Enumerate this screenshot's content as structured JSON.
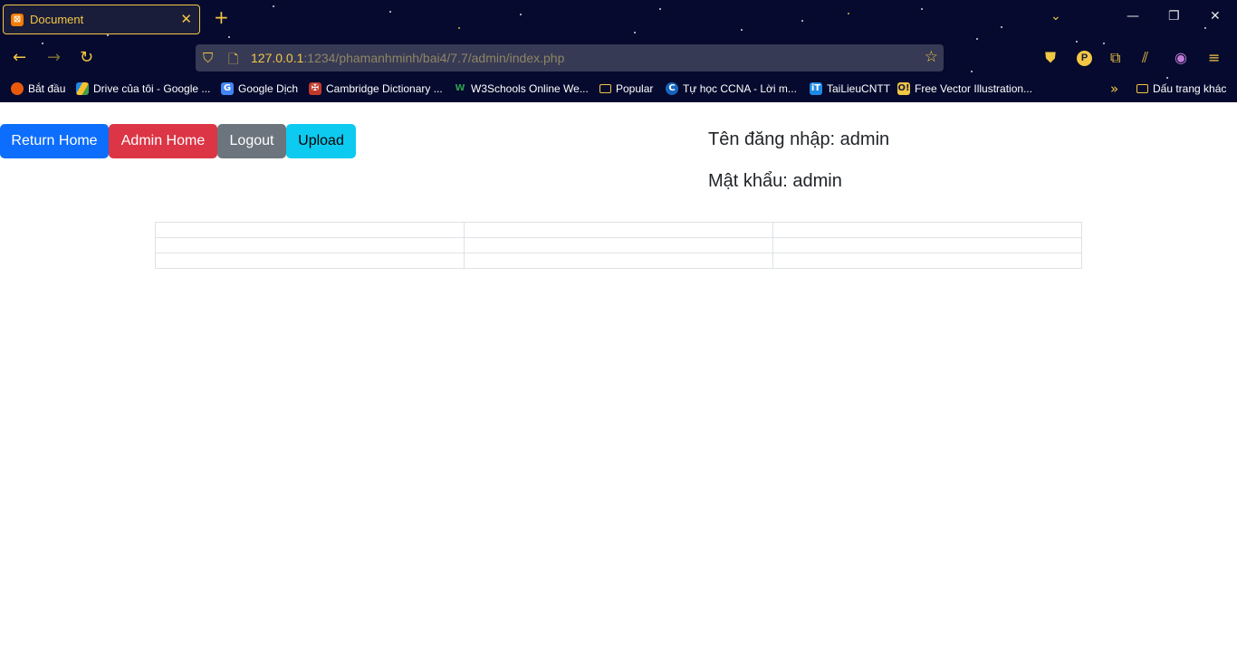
{
  "browser": {
    "tab_title": "Document",
    "url_host": "127.0.0.1",
    "url_rest": ":1234/phamanhminh/bai4/7.7/admin/index.php",
    "profile_letter": "P",
    "bookmarks": [
      {
        "label": "Bắt đầu",
        "icon": "firefox-icon"
      },
      {
        "label": "Drive của tôi - Google ...",
        "icon": "google-drive-icon"
      },
      {
        "label": "Google Dịch",
        "icon": "google-translate-icon"
      },
      {
        "label": "Cambridge Dictionary ...",
        "icon": "cambridge-icon"
      },
      {
        "label": "W3Schools Online We...",
        "icon": "w3schools-icon"
      },
      {
        "label": "Popular",
        "icon": "folder-icon"
      },
      {
        "label": "Tự học CCNA - Lời m...",
        "icon": "ccna-icon"
      },
      {
        "label": "TaiLieuCNTT",
        "icon": "tailieu-icon"
      },
      {
        "label": "Free Vector Illustration...",
        "icon": "vector-icon"
      }
    ],
    "other_bookmarks": "Dấu trang khác"
  },
  "page": {
    "buttons": {
      "return_home": "Return Home",
      "admin_home": "Admin Home",
      "logout": "Logout",
      "upload": "Upload"
    },
    "username_line": "Tên đăng nhập: admin",
    "password_line": "Mật khẩu: admin",
    "table_rows": [
      [
        "",
        "",
        ""
      ],
      [
        "",
        "",
        ""
      ],
      [
        "",
        "",
        ""
      ]
    ]
  },
  "colors": {
    "primary": "#0d6efd",
    "danger": "#dc3545",
    "secondary": "#6c757d",
    "info": "#0dcaf0",
    "chrome_bg": "#050a2e",
    "accent": "#f2c744"
  }
}
